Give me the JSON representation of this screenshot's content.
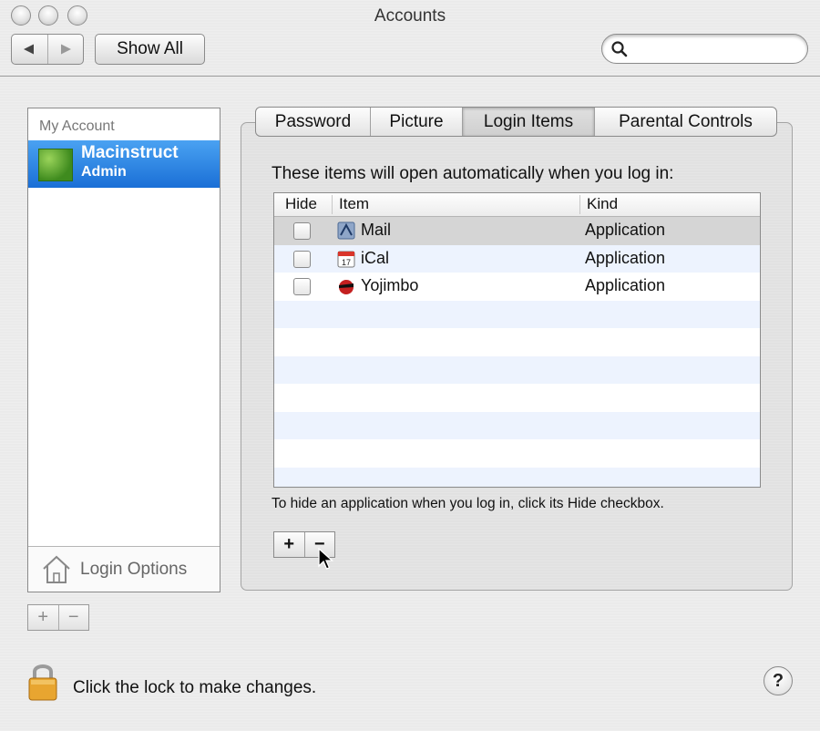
{
  "window": {
    "title": "Accounts"
  },
  "toolbar": {
    "back_icon": "back-arrow-icon",
    "forward_icon": "forward-arrow-icon",
    "show_all_label": "Show All",
    "search": {
      "value": "",
      "placeholder": ""
    }
  },
  "sidebar": {
    "section_header": "My Account",
    "selected_account": {
      "name": "Macinstruct",
      "role": "Admin"
    },
    "login_options_label": "Login Options",
    "add_label": "+",
    "remove_label": "−"
  },
  "tabs": [
    {
      "label": "Password",
      "active": false
    },
    {
      "label": "Picture",
      "active": false
    },
    {
      "label": "Login Items",
      "active": true
    },
    {
      "label": "Parental Controls",
      "active": false
    }
  ],
  "login_items": {
    "intro": "These items will open automatically when you log in:",
    "columns": [
      "Hide",
      "Item",
      "Kind"
    ],
    "rows": [
      {
        "hide": false,
        "item": "Mail",
        "kind": "Application",
        "icon": "mail-app-icon",
        "selected": true
      },
      {
        "hide": false,
        "item": "iCal",
        "kind": "Application",
        "icon": "ical-app-icon",
        "selected": false
      },
      {
        "hide": false,
        "item": "Yojimbo",
        "kind": "Application",
        "icon": "yojimbo-app-icon",
        "selected": false
      }
    ],
    "hint": "To hide an application when you log in, click its Hide checkbox.",
    "add_label": "+",
    "remove_label": "−"
  },
  "footer": {
    "lock_text": "Click the lock to make changes.",
    "help_label": "?"
  },
  "colors": {
    "selection": "#1a6fd6",
    "alt_row": "#edf3fe",
    "lock_gold": "#e8a530"
  }
}
